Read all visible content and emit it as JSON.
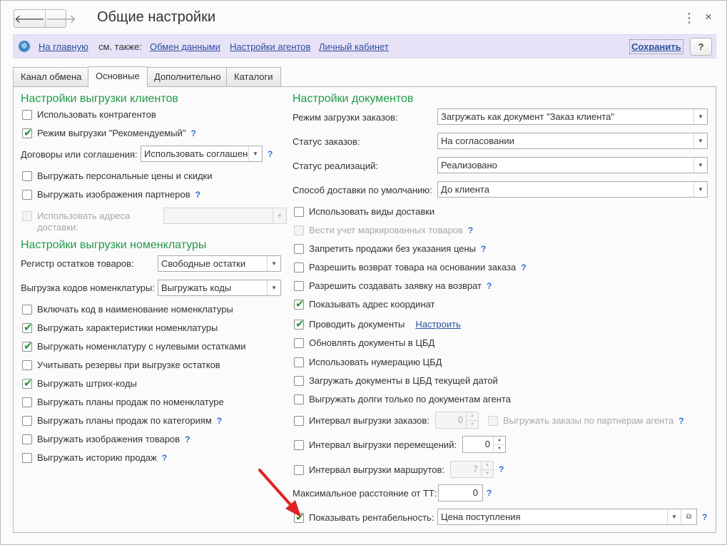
{
  "window": {
    "title": "Общие настройки",
    "back_icon": "arrow-left-icon",
    "forward_icon": "arrow-right-icon",
    "menu_glyph": "⋮",
    "close_glyph": "×"
  },
  "commandbar": {
    "home": "На главную",
    "see_also": "см. также:",
    "links": [
      "Обмен данными",
      "Настройки агентов",
      "Личный кабинет"
    ],
    "save": "Сохранить",
    "help": "?"
  },
  "tabs": [
    "Канал обмена",
    "Основные",
    "Дополнительно",
    "Каталоги"
  ],
  "left": {
    "clients": {
      "title": "Настройки выгрузки клиентов",
      "use_contractors": {
        "label": "Использовать контрагентов",
        "checked": false
      },
      "recommended_mode": {
        "label": "Режим выгрузки \"Рекомендуемый\"",
        "checked": true
      },
      "contracts_label": "Договоры или соглашения:",
      "contracts_value": "Использовать соглашения",
      "personal_prices": {
        "label": "Выгружать персональные цены и скидки",
        "checked": false
      },
      "partner_images": {
        "label": "Выгружать изображения партнеров",
        "checked": false
      },
      "delivery_addresses": {
        "label_line1": "Использовать адреса",
        "label_line2": "доставки:",
        "checked": false
      }
    },
    "nomenclature": {
      "title": "Настройки выгрузки номенклатуры",
      "stock_register_label": "Регистр остатков товаров:",
      "stock_register_value": "Свободные остатки",
      "codes_label": "Выгрузка кодов номенклатуры:",
      "codes_value": "Выгружать коды",
      "checkboxes": [
        {
          "label": "Включать код в наименование номенклатуры",
          "checked": false,
          "help": false
        },
        {
          "label": "Выгружать характеристики номенклатуры",
          "checked": true,
          "help": false
        },
        {
          "label": "Выгружать номенклатуру с нулевыми остатками",
          "checked": true,
          "help": false
        },
        {
          "label": "Учитывать резервы при выгрузке остатков",
          "checked": false,
          "help": false
        },
        {
          "label": "Выгружать штрих-коды",
          "checked": true,
          "help": false
        },
        {
          "label": "Выгружать планы продаж по номенклатуре",
          "checked": false,
          "help": false
        },
        {
          "label": "Выгружать планы продаж по категориям",
          "checked": false,
          "help": true
        },
        {
          "label": "Выгружать изображения товаров",
          "checked": false,
          "help": true
        },
        {
          "label": "Выгружать историю продаж",
          "checked": false,
          "help": true
        }
      ]
    }
  },
  "right": {
    "title": "Настройки документов",
    "order_mode": {
      "label": "Режим загрузки заказов:",
      "value": "Загружать как документ \"Заказ клиента\""
    },
    "order_status": {
      "label": "Статус заказов:",
      "value": "На согласовании"
    },
    "sales_status": {
      "label": "Статус реализаций:",
      "value": "Реализовано"
    },
    "delivery_method": {
      "label": "Способ доставки по умолчанию:",
      "value": "До клиента"
    },
    "checkboxes": [
      {
        "label": "Использовать виды доставки",
        "checked": false,
        "help": false,
        "disabled": false
      },
      {
        "label": "Вести учет маркированных товаров",
        "checked": false,
        "help": true,
        "disabled": true
      },
      {
        "label": "Запретить продажи без указания цены",
        "checked": false,
        "help": true,
        "disabled": false
      },
      {
        "label": "Разрешить возврат товара на основании заказа",
        "checked": false,
        "help": true,
        "disabled": false
      },
      {
        "label": "Разрешить создавать заявку на возврат",
        "checked": false,
        "help": true,
        "disabled": false
      },
      {
        "label": "Показывать адрес координат",
        "checked": true,
        "help": false,
        "disabled": false
      },
      {
        "label": "Проводить документы",
        "checked": true,
        "help": false,
        "disabled": false
      },
      {
        "label": "Обновлять документы в ЦБД",
        "checked": false,
        "help": false,
        "disabled": false
      },
      {
        "label": "Использовать нумерацию ЦБД",
        "checked": false,
        "help": false,
        "disabled": false
      },
      {
        "label": "Загружать документы в ЦБД текущей датой",
        "checked": false,
        "help": false,
        "disabled": false
      },
      {
        "label": "Выгружать долги только по документам агента",
        "checked": false,
        "help": false,
        "disabled": false
      }
    ],
    "configure_link": "Настроить",
    "order_interval": {
      "label": "Интервал выгрузки заказов:",
      "value": "0",
      "checked": false
    },
    "partner_orders": {
      "label": "Выгружать заказы по партнерам агента",
      "checked": false
    },
    "transfer_interval": {
      "label": "Интервал выгрузки перемещений:",
      "value": "0",
      "checked": false
    },
    "route_interval": {
      "label": "Интервал выгрузки маршрутов:",
      "value": "7",
      "checked": false
    },
    "max_distance": {
      "label": "Максимальное расстояние от ТТ:",
      "value": "0"
    },
    "profitability": {
      "label": "Показывать рентабельность:",
      "value": "Цена поступления",
      "checked": true
    }
  },
  "annotation_color": "#e02020"
}
